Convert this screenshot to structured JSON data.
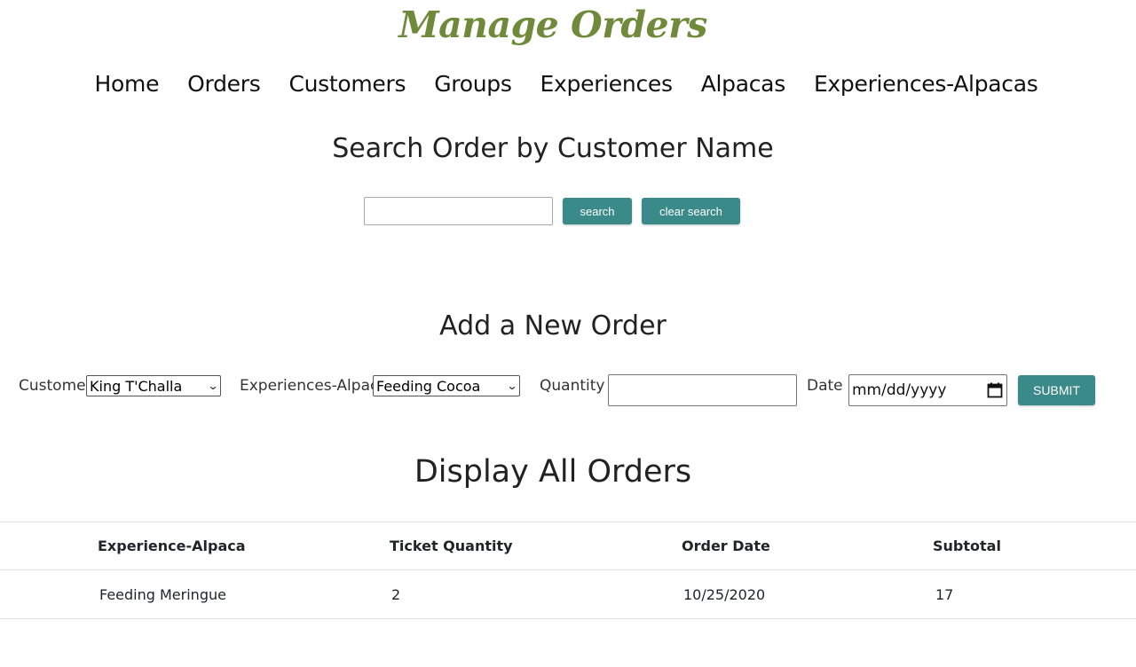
{
  "page_title": "Manage Orders",
  "nav": [
    "Home",
    "Orders",
    "Customers",
    "Groups",
    "Experiences",
    "Alpacas",
    "Experiences-Alpacas"
  ],
  "search_section": {
    "heading": "Search Order by Customer Name",
    "input_value": "",
    "search_button": "search",
    "clear_button": "clear search"
  },
  "add_section": {
    "heading": "Add a New Order",
    "customer_label": "Customer",
    "customer_selected": "King T'Challa",
    "experience_label": "Experiences-Alpaca",
    "experience_selected": "Feeding Cocoa",
    "quantity_label": "Quantity",
    "quantity_value": "",
    "date_label": "Date",
    "date_placeholder": "mm/dd/yyyy",
    "submit_button": "SUBMIT"
  },
  "display_section": {
    "heading": "Display All Orders",
    "columns": [
      "Experience-Alpaca",
      "Ticket Quantity",
      "Order Date",
      "Subtotal"
    ],
    "rows": [
      [
        "Feeding Meringue",
        "2",
        "10/25/2020",
        "17"
      ]
    ]
  },
  "colors": {
    "title": "#6f8a3a",
    "button": "#3a8a8a"
  }
}
